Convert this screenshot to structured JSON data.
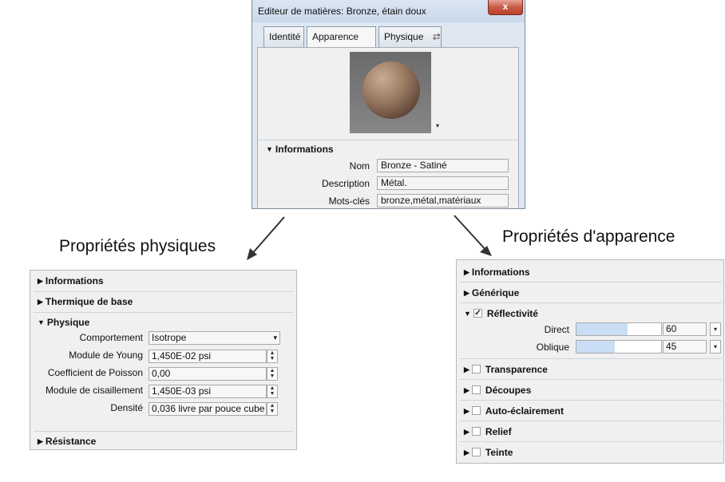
{
  "dialog": {
    "title": "Editeur de matières: Bronze, étain doux",
    "close_glyph": "x",
    "tabs": [
      {
        "label": "Identité"
      },
      {
        "label": "Apparence",
        "icon": "⇄"
      },
      {
        "label": "Physique",
        "icon": "⇄"
      }
    ],
    "swatch_arrow": "▾",
    "info_section": "Informations",
    "fields": [
      {
        "label": "Nom",
        "value": "Bronze - Satiné"
      },
      {
        "label": "Description",
        "value": "Métal."
      },
      {
        "label": "Mots-clés",
        "value": "bronze,métal,matériaux"
      }
    ]
  },
  "captions": {
    "physical": "Propriétés physiques",
    "appearance": "Propriétés d'apparence"
  },
  "physical_panel": {
    "sections": [
      "Informations",
      "Thermique de base",
      "Physique",
      "Résistance"
    ],
    "rows": [
      {
        "label": "Comportement",
        "value": "Isotrope",
        "control": "dropdown"
      },
      {
        "label": "Module de Young",
        "value": "1,450E-02 psi",
        "control": "spinner"
      },
      {
        "label": "Coefficient de Poisson",
        "value": "0,00",
        "control": "spinner"
      },
      {
        "label": "Module de cisaillement",
        "value": "1,450E-03 psi",
        "control": "spinner"
      },
      {
        "label": "Densité",
        "value": "0,036 livre par pouce cube",
        "control": "spinner"
      }
    ]
  },
  "appearance_panel": {
    "sections": [
      "Informations",
      "Générique"
    ],
    "reflectivity": {
      "label": "Réflectivité",
      "checked": true,
      "rows": [
        {
          "label": "Direct",
          "value": "60",
          "fill": 0.6
        },
        {
          "label": "Oblique",
          "value": "45",
          "fill": 0.45
        }
      ]
    },
    "checkable_sections": [
      {
        "label": "Transparence",
        "checked": false
      },
      {
        "label": "Découpes",
        "checked": false
      },
      {
        "label": "Auto-éclairement",
        "checked": false
      },
      {
        "label": "Relief",
        "checked": false
      },
      {
        "label": "Teinte",
        "checked": false
      }
    ]
  },
  "glyphs": {
    "expanded": "▼",
    "collapsed": "▶",
    "check": "✓",
    "spin_up": "▲",
    "spin_down": "▼",
    "dropdown": "▾"
  }
}
